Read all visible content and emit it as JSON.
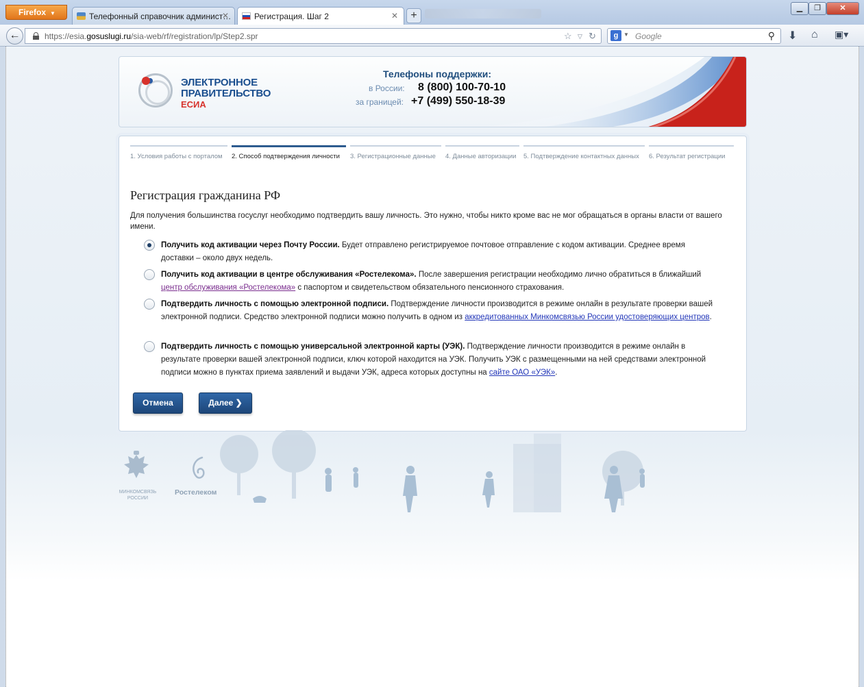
{
  "browser": {
    "menu_button": "Firefox",
    "tabs": [
      {
        "title": "Телефонный справочник админист…",
        "active": false
      },
      {
        "title": "Регистрация. Шаг 2",
        "active": true
      }
    ],
    "new_tab": "+",
    "url_prefix": "https://esia.",
    "url_domain": "gosuslugi.ru",
    "url_path": "/sia-web/rf/registration/lp/Step2.spr",
    "search_placeholder": "Google"
  },
  "header": {
    "logo_line1": "ЭЛЕКТРОННОЕ",
    "logo_line2": "ПРАВИТЕЛЬСТВО",
    "logo_line3": "ЕСИА",
    "support_title": "Телефоны поддержки:",
    "support_ru_label": "в России:",
    "support_ru_phone": "8 (800) 100-70-10",
    "support_abroad_label": "за границей:",
    "support_abroad_phone": "+7 (499) 550-18-39"
  },
  "steps": [
    {
      "label": "1. Условия работы с порталом",
      "active": false
    },
    {
      "label": "2. Способ подтверждения личности",
      "active": true
    },
    {
      "label": "3. Регистрационные данные",
      "active": false
    },
    {
      "label": "4. Данные авторизации",
      "active": false
    },
    {
      "label": "5. Подтверждение контактных данных",
      "active": false
    },
    {
      "label": "6. Результат регистрации",
      "active": false
    }
  ],
  "form": {
    "heading": "Регистрация гражданина РФ",
    "intro": "Для получения большинства госуслуг необходимо подтвердить вашу личность. Это нужно, чтобы никто кроме вас не мог обращаться в органы власти от вашего имени.",
    "options": [
      {
        "checked": true,
        "title": "Получить код активации через Почту России.",
        "text": " Будет отправлено регистрируемое почтовое отправление с кодом активации. Среднее время доставки – около двух недель."
      },
      {
        "checked": false,
        "title": "Получить код активации в центре обслуживания «Ростелекома».",
        "text_before": " После завершения регистрации необходимо лично обратиться в ближайший ",
        "link": "центр обслуживания «Ростелекома»",
        "text_after": " с паспортом и свидетельством обязательного пенсионного страхования."
      },
      {
        "checked": false,
        "title": "Подтвердить личность с помощью электронной подписи.",
        "text_before": " Подтверждение личности производится в режиме онлайн в результате проверки вашей электронной подписи. Средство электронной подписи можно получить в одном из ",
        "link": "аккредитованных Минкомсвязью России удостоверяющих центров",
        "text_after": "."
      },
      {
        "checked": false,
        "title": "Подтвердить личность с помощью универсальной электронной карты (УЭК).",
        "text_before": " Подтверждение личности производится в режиме онлайн в результате проверки вашей электронной подписи, ключ которой находится на УЭК. Получить УЭК с размещенными на ней средствами электронной подписи можно в пунктах приема заявлений и выдачи УЭК, адреса которых доступны на ",
        "link": "сайте ОАО «УЭК»",
        "text_after": "."
      }
    ],
    "cancel_button": "Отмена",
    "next_button": "Далее ❯"
  },
  "footer": {
    "minkom_line1": "МИНКОМСВЯЗЬ",
    "minkom_line2": "РОССИИ",
    "rostelecom": "Ростелеком"
  },
  "colors": {
    "primary_button": "#1f4a80",
    "link": "#2236b8",
    "visited_link": "#7a2d8e",
    "logo_blue": "#1b4f8f",
    "logo_red": "#d7322b"
  }
}
